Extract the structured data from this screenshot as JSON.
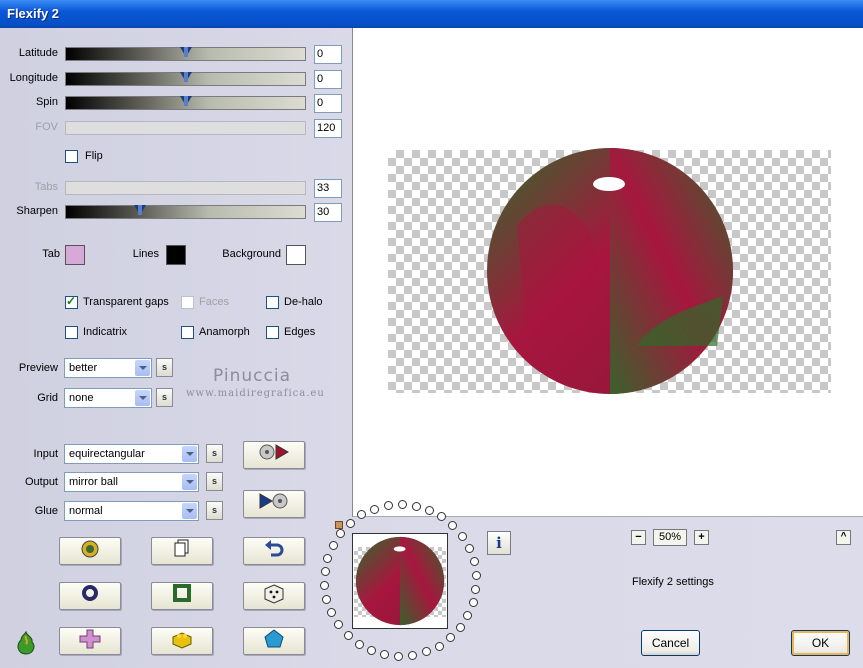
{
  "window": {
    "title": "Flexify 2"
  },
  "sliders": {
    "latitude": {
      "label": "Latitude",
      "value": "0",
      "level": 0.5,
      "enabled": true
    },
    "longitude": {
      "label": "Longitude",
      "value": "0",
      "level": 0.5,
      "enabled": true
    },
    "spin": {
      "label": "Spin",
      "value": "0",
      "level": 0.5,
      "enabled": true
    },
    "fov": {
      "label": "FOV",
      "value": "120",
      "enabled": false
    },
    "tabs": {
      "label": "Tabs",
      "value": "33",
      "enabled": false
    },
    "sharpen": {
      "label": "Sharpen",
      "value": "30",
      "level": 0.3,
      "enabled": true
    }
  },
  "flip": {
    "label": "Flip",
    "checked": false
  },
  "colors": {
    "tab": {
      "label": "Tab",
      "color": "#d8a8d8"
    },
    "lines": {
      "label": "Lines",
      "color": "#000000"
    },
    "background": {
      "label": "Background",
      "color": "#ffffff"
    }
  },
  "options": {
    "transparent_gaps": {
      "label": "Transparent gaps",
      "checked": true
    },
    "faces": {
      "label": "Faces",
      "checked": false,
      "enabled": false
    },
    "dehalo": {
      "label": "De-halo",
      "checked": false
    },
    "indicatrix": {
      "label": "Indicatrix",
      "checked": false
    },
    "anamorph": {
      "label": "Anamorph",
      "checked": false
    },
    "edges": {
      "label": "Edges",
      "checked": false
    }
  },
  "dropdowns": {
    "preview": {
      "label": "Preview",
      "value": "better"
    },
    "grid": {
      "label": "Grid",
      "value": "none"
    },
    "input": {
      "label": "Input",
      "value": "equirectangular"
    },
    "output": {
      "label": "Output",
      "value": "mirror ball"
    },
    "glue": {
      "label": "Glue",
      "value": "normal"
    }
  },
  "s_button_label": "s",
  "watermark": {
    "name": "Pinuccia",
    "url": "www.maidiregrafica.eu"
  },
  "zoom": {
    "minus": "−",
    "value": "50%",
    "plus": "+"
  },
  "settings_label": "Flexify 2 settings",
  "buttons": {
    "cancel": "Cancel",
    "ok": "OK",
    "info": "i",
    "collapse": "^"
  },
  "icons": {
    "random_settings": "dice-icon",
    "undo": "undo-arrow-icon",
    "copy": "copy-pages-icon"
  },
  "accent_colors": {
    "sphere_red": "#a8163e",
    "sphere_green": "#2f6a2a"
  }
}
